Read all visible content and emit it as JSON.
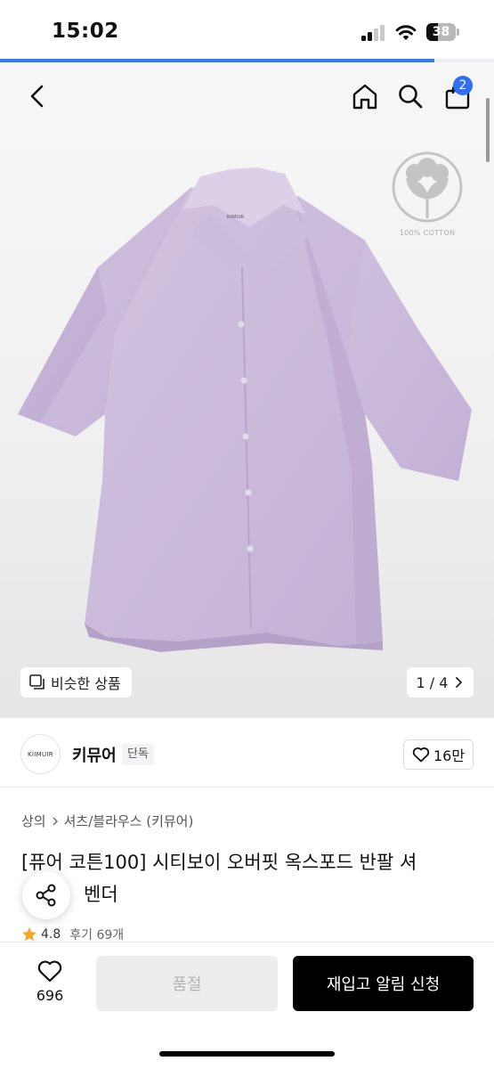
{
  "status_bar": {
    "time": "15:02",
    "battery": "38",
    "battery_level": 0.38
  },
  "page_load_progress": 0.88,
  "header": {
    "back_icon": "chevron-left-icon",
    "home_icon": "home-icon",
    "search_icon": "search-icon",
    "cart_icon": "shopping-bag-icon",
    "cart_badge": "2"
  },
  "hero": {
    "cotton_badge_text": "100% COTTON",
    "shirt_label": "KIIMUIR",
    "similar_button_label": "비슷한 상품",
    "page_counter": "1 / 4"
  },
  "brand": {
    "logo_text": "KIIMUIR",
    "name": "키뮤어",
    "tag": "단독",
    "like_count": "16만"
  },
  "product": {
    "breadcrumb": [
      "상의",
      "셔츠/블라우스 (키뮤어)"
    ],
    "title_line1": "[퓨어 코튼100] 시티보이 오버핏 옥스포드 반팔 셔",
    "title_line2": "벤더",
    "rating": "4.8",
    "reviews": "후기 69개"
  },
  "bottom_bar": {
    "wish_count": "696",
    "soldout_label": "품절",
    "restock_label": "재입고 알림 신청"
  },
  "colors": {
    "accent": "#2f6ef5",
    "shirt": "#c9b8d9",
    "star": "#f5a623",
    "primary_button": "#000000"
  }
}
